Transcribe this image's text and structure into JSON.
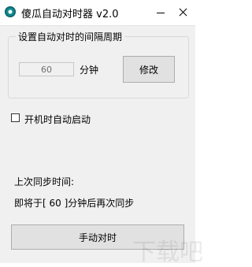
{
  "window": {
    "title": "傻瓜自动对时器 v2.0",
    "icon": "clock-sync-icon",
    "controls": [
      "minimize-icon",
      "close-icon"
    ]
  },
  "interval_group": {
    "title": "设置自动对时的间隔周期",
    "value": "60",
    "unit": "分钟",
    "modify_button": "修改"
  },
  "autostart": {
    "label": "开机时自动启动",
    "checked": false
  },
  "status": {
    "last_sync": "上次同步时间:",
    "next_sync": "即将于[ 60 ]分钟后再次同步"
  },
  "sync_button": "手动对时",
  "watermark": "下载吧"
}
